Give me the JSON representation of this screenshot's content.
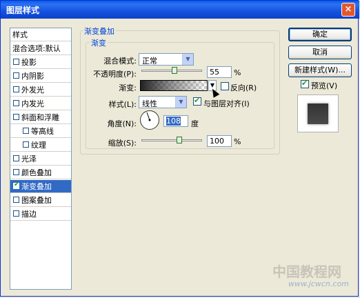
{
  "window": {
    "title": "图层样式",
    "close": "×"
  },
  "sidebar": {
    "items": [
      {
        "label": "样式",
        "type": "header"
      },
      {
        "label": "混合选项:默认",
        "type": "header"
      },
      {
        "label": "投影",
        "checked": false
      },
      {
        "label": "内阴影",
        "checked": false
      },
      {
        "label": "外发光",
        "checked": false
      },
      {
        "label": "内发光",
        "checked": false
      },
      {
        "label": "斜面和浮雕",
        "checked": false
      },
      {
        "label": "等高线",
        "checked": false,
        "indent": true
      },
      {
        "label": "纹理",
        "checked": false,
        "indent": true
      },
      {
        "label": "光泽",
        "checked": false
      },
      {
        "label": "颜色叠加",
        "checked": false
      },
      {
        "label": "渐变叠加",
        "checked": true,
        "selected": true
      },
      {
        "label": "图案叠加",
        "checked": false
      },
      {
        "label": "描边",
        "checked": false
      }
    ]
  },
  "panel": {
    "group_title": "渐变叠加",
    "inner_title": "渐变",
    "blend_mode_label": "混合模式:",
    "blend_mode_value": "正常",
    "opacity_label": "不透明度(P):",
    "opacity_value": "55",
    "percent": "%",
    "gradient_label": "渐变:",
    "reverse_label": "反向(R)",
    "style_label": "样式(L):",
    "style_value": "线性",
    "align_label": "与图层对齐(I)",
    "align_checked": true,
    "angle_label": "角度(N):",
    "angle_value": "108",
    "degree": "度",
    "scale_label": "缩放(S):",
    "scale_value": "100",
    "opacity_level": 0.55,
    "scale_level": 1.0
  },
  "buttons": {
    "ok": "确定",
    "cancel": "取消",
    "new_style": "新建样式(W)...",
    "preview_label": "预览(V)",
    "preview_checked": true
  },
  "watermark": {
    "main": "中国教程网",
    "url": "www.jcwcn.com"
  }
}
